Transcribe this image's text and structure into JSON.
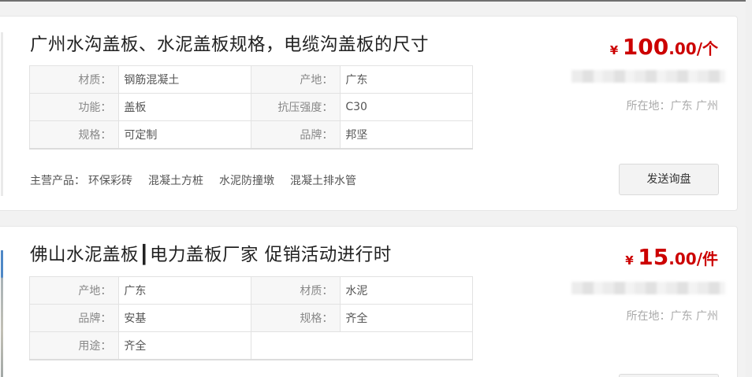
{
  "listings": [
    {
      "title": "广州水沟盖板、水泥盖板规格，电缆沟盖板的尺寸",
      "price": {
        "currency": "¥",
        "integer": "100",
        "decimal": ".00",
        "unit": "/个"
      },
      "location": "所在地：广东 广州",
      "specs": [
        {
          "k1": "材质：",
          "v1": "钢筋混凝土",
          "k2": "产地：",
          "v2": "广东"
        },
        {
          "k1": "功能：",
          "v1": "盖板",
          "k2": "抗压强度：",
          "v2": "C30"
        },
        {
          "k1": "规格：",
          "v1": "可定制",
          "k2": "品牌：",
          "v2": "邦坚"
        }
      ],
      "main_products_label": "主营产品：",
      "main_products": [
        "环保彩砖",
        "混凝土方桩",
        "水泥防撞墩",
        "混凝土排水管"
      ],
      "inquiry_button": "发送询盘"
    },
    {
      "title": "佛山水泥盖板┃电力盖板厂家 促销活动进行时",
      "price": {
        "currency": "¥",
        "integer": "15",
        "decimal": ".00",
        "unit": "/件"
      },
      "location": "所在地：广东 广州",
      "specs": [
        {
          "k1": "产地：",
          "v1": "广东",
          "k2": "材质：",
          "v2": "水泥"
        },
        {
          "k1": "品牌：",
          "v1": "安基",
          "k2": "规格：",
          "v2": "齐全"
        },
        {
          "k1": "用途：",
          "v1": "齐全",
          "k2": "",
          "v2": ""
        }
      ]
    }
  ]
}
